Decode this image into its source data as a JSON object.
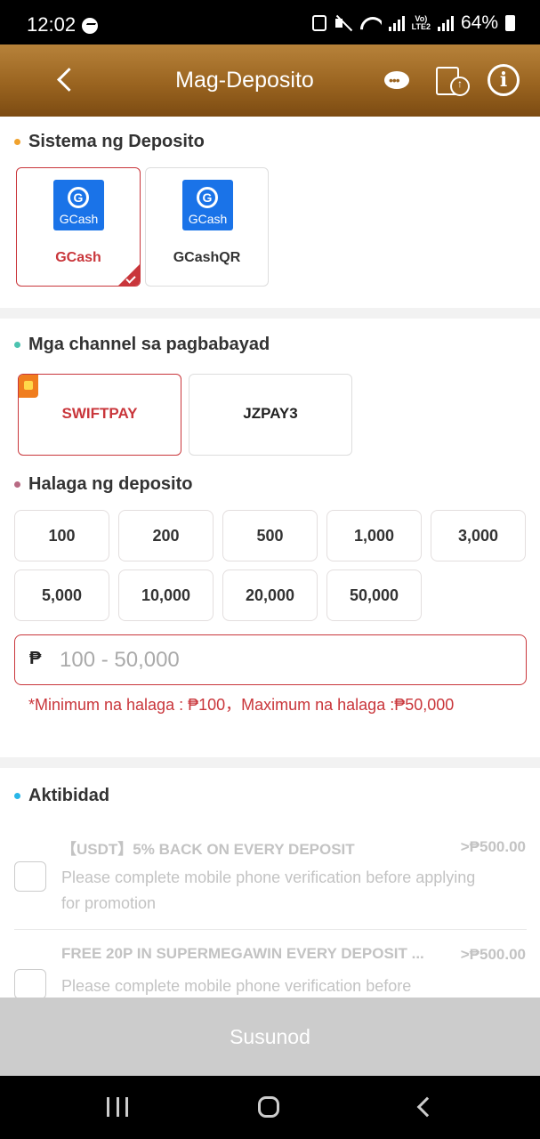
{
  "status_bar": {
    "time": "12:02",
    "volte": "Vo)\nLTE2",
    "battery": "64%"
  },
  "header": {
    "title": "Mag-Deposito",
    "icons": [
      "back-icon",
      "support-icon",
      "clipboard-upload-icon",
      "info-icon"
    ],
    "info_glyph": "i"
  },
  "deposit_system": {
    "title": "Sistema ng Deposito",
    "dot_color": "#f0a22e",
    "options": [
      {
        "label": "GCash",
        "logo_text": "GCash",
        "selected": true
      },
      {
        "label": "GCashQR",
        "logo_text": "GCash",
        "selected": false
      }
    ]
  },
  "channels": {
    "title": "Mga channel sa pagbabayad",
    "dot_color": "#4cc3b0",
    "options": [
      {
        "label": "SWIFTPAY",
        "selected": true
      },
      {
        "label": "JZPAY3",
        "selected": false
      }
    ]
  },
  "amount": {
    "title": "Halaga ng deposito",
    "dot_color": "#b86a83",
    "presets": [
      "100",
      "200",
      "500",
      "1,000",
      "3,000",
      "5,000",
      "10,000",
      "20,000",
      "50,000"
    ],
    "currency": "₱",
    "placeholder": "100 - 50,000",
    "hint": "*Minimum na halaga : ₱100，Maximum na halaga :₱50,000"
  },
  "activity": {
    "title": "Aktibidad",
    "dot_color": "#29b6e8",
    "items": [
      {
        "title": "【USDT】5% BACK ON EVERY DEPOSIT",
        "amount": ">₱500.00",
        "desc": "Please complete mobile phone verification before applying for promotion"
      },
      {
        "title": "FREE 20P IN SUPERMEGAWIN EVERY DEPOSIT ...",
        "amount": ">₱500.00",
        "desc": "Please complete mobile phone verification before"
      }
    ]
  },
  "submit": {
    "label": "Susunod"
  },
  "colors": {
    "accent": "#c9363b",
    "header_gold": "#9a6420",
    "disabled": "#cccccc"
  }
}
